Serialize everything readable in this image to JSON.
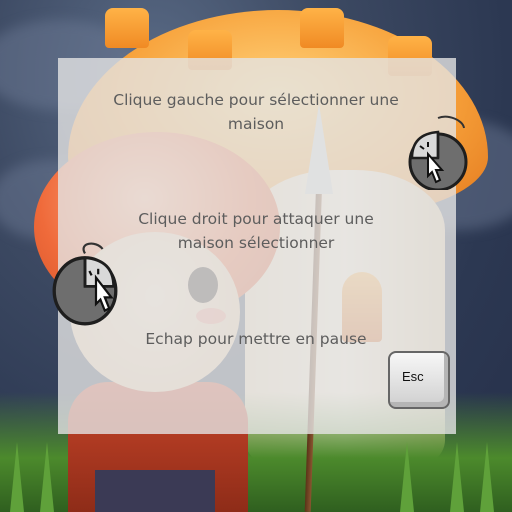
{
  "instructions": {
    "left_click": [
      "Clique gauche pour sélectionner une",
      "maison"
    ],
    "right_click": [
      "Clique droit pour attaquer une",
      "maison sélectionner"
    ],
    "escape": "Echap pour mettre en pause"
  },
  "keys": {
    "esc_label": "Esc"
  },
  "icons": {
    "left_click_icon": "mouse-left-click-icon",
    "right_click_icon": "mouse-right-click-icon",
    "esc_key_icon": "esc-key-icon"
  },
  "colors": {
    "panel_bg": "#e4e4e4",
    "text": "#5d5d5d",
    "sky": "#3d4a63",
    "mushroom_cap": "#f7a23b",
    "hero_cap": "#ef6a3a"
  }
}
